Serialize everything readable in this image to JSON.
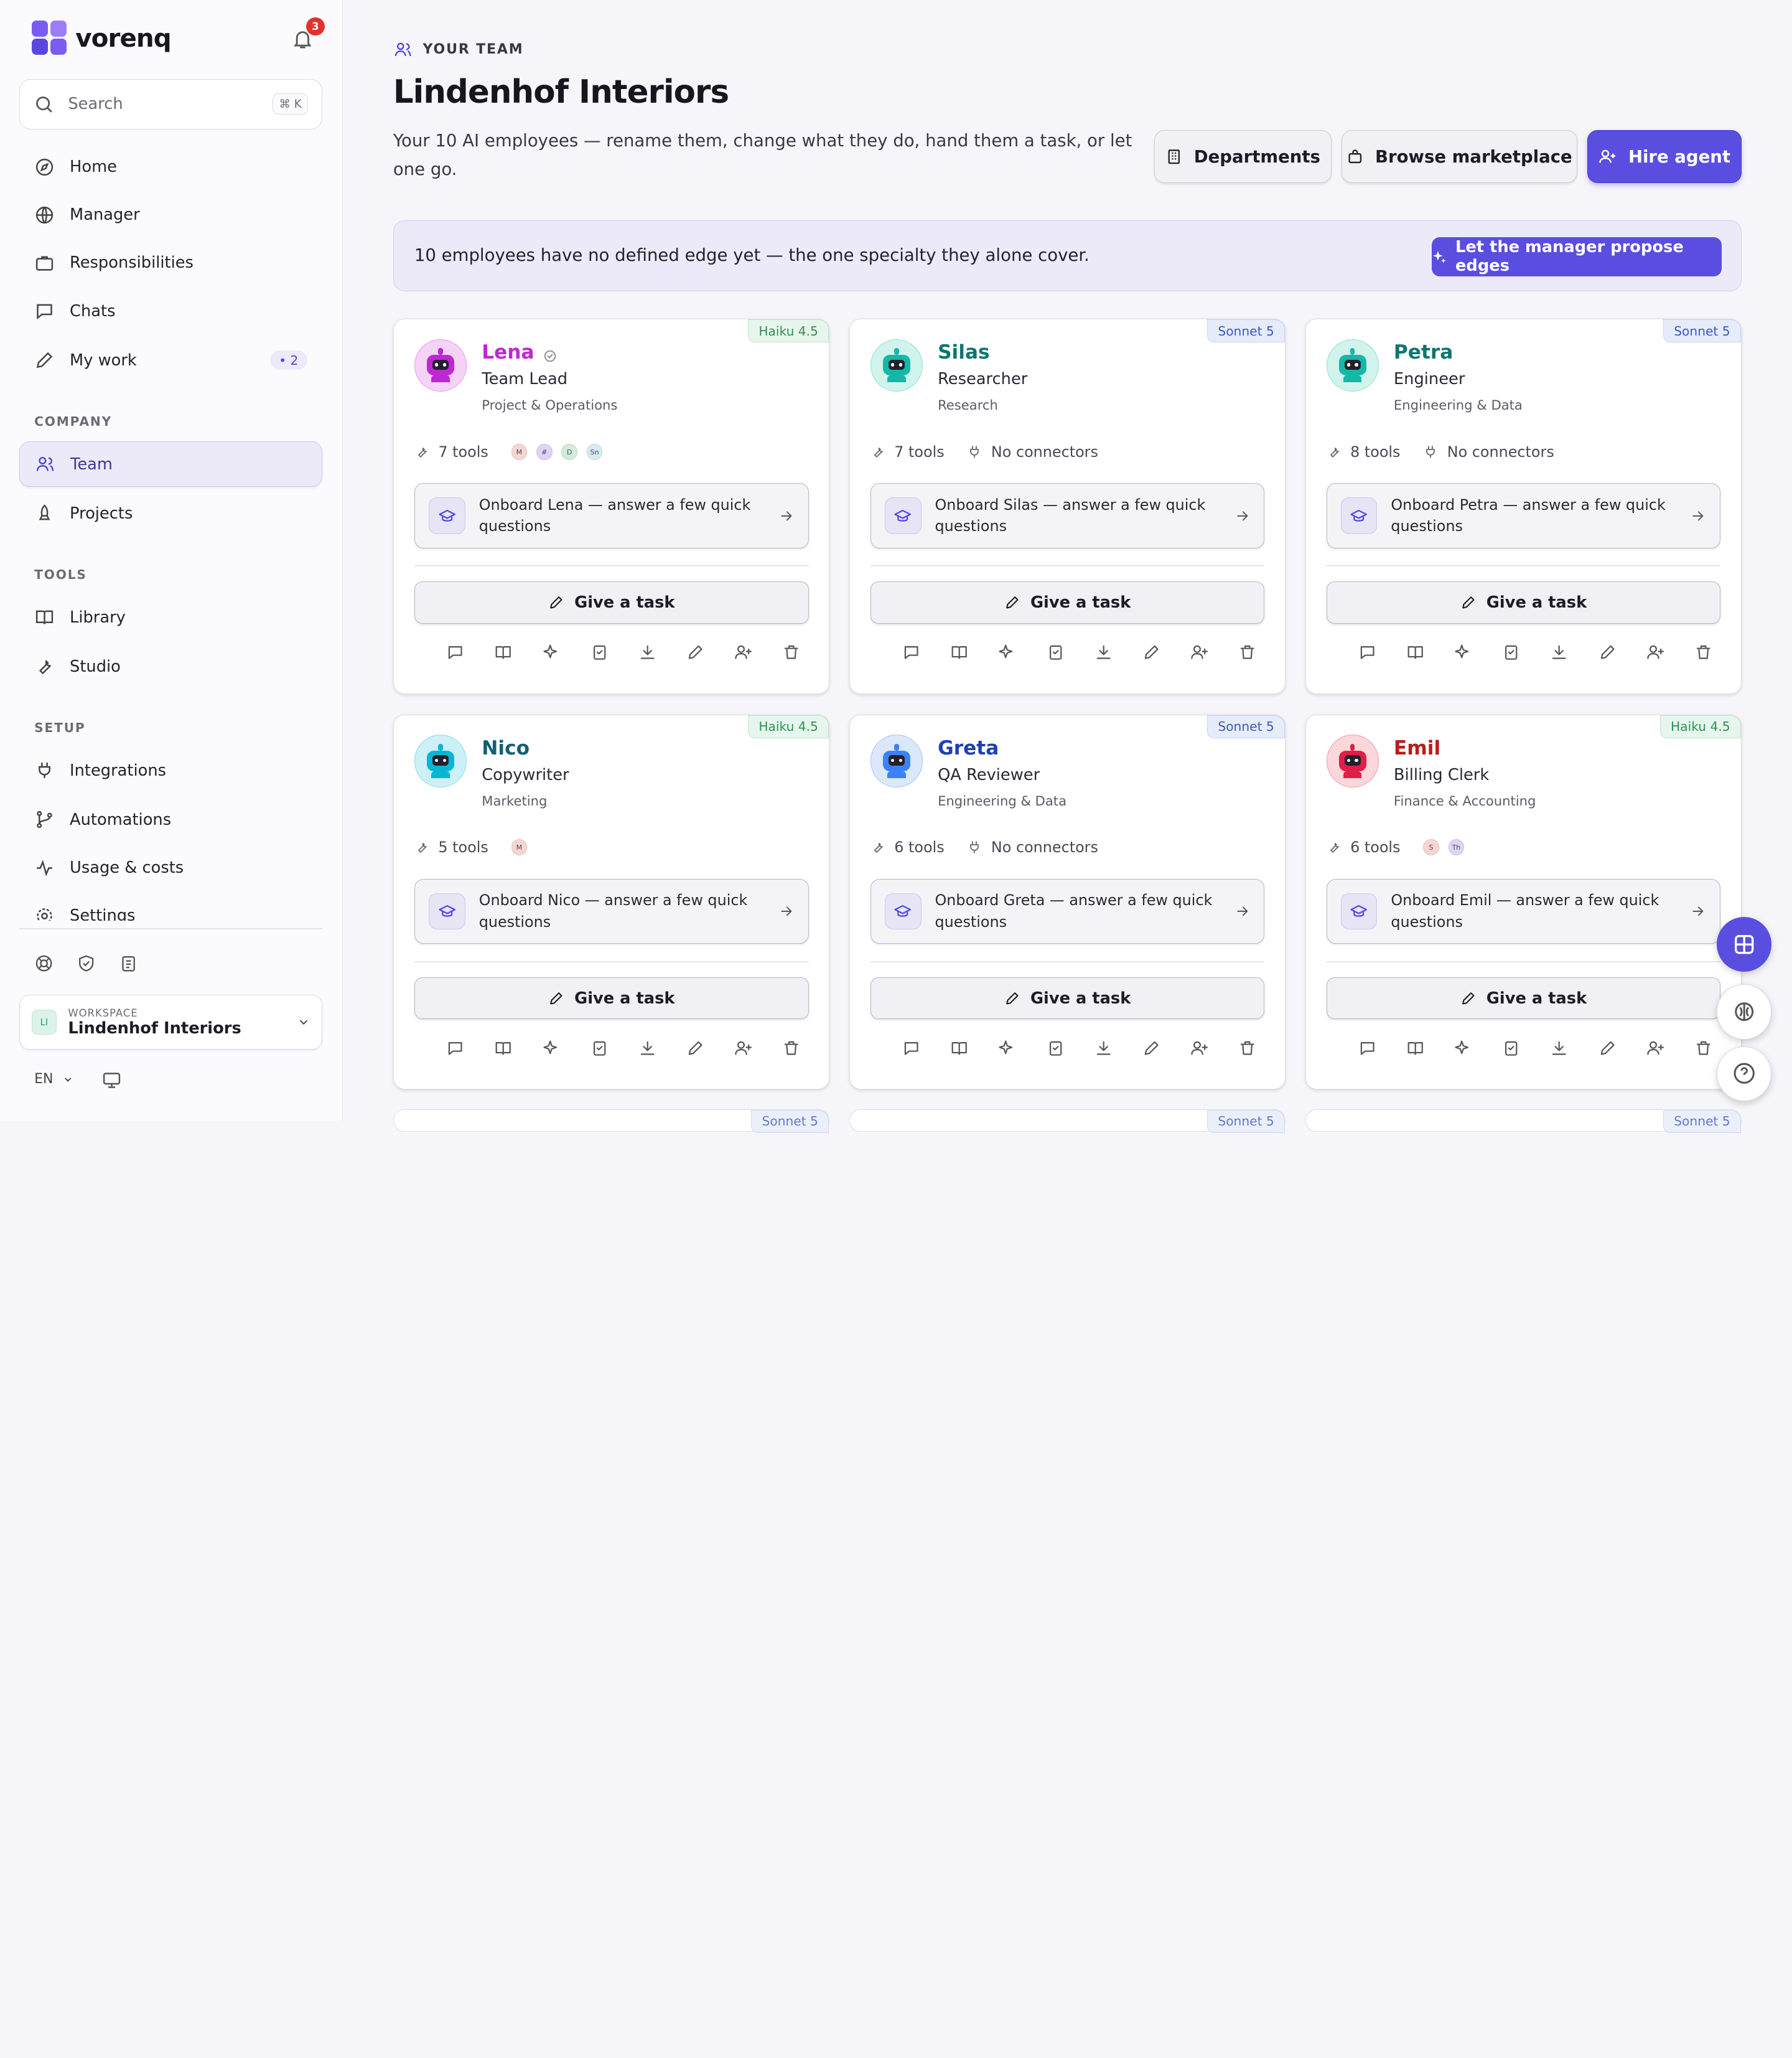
{
  "app": {
    "name": "vorenq",
    "notification_count": "3"
  },
  "search": {
    "placeholder": "Search",
    "shortcut": "⌘ K"
  },
  "nav": {
    "main": [
      {
        "label": "Home",
        "icon": "compass-icon"
      },
      {
        "label": "Manager",
        "icon": "globe-icon"
      },
      {
        "label": "Responsibilities",
        "icon": "briefcase-icon"
      },
      {
        "label": "Chats",
        "icon": "chat-icon"
      },
      {
        "label": "My work",
        "icon": "pencil-icon",
        "count": "• 2"
      }
    ],
    "company_title": "COMPANY",
    "company": [
      {
        "label": "Team"
      },
      {
        "label": "Projects"
      }
    ],
    "tools_title": "TOOLS",
    "tools": [
      {
        "label": "Library"
      },
      {
        "label": "Studio"
      }
    ],
    "setup_title": "SETUP",
    "setup": [
      {
        "label": "Integrations"
      },
      {
        "label": "Automations"
      },
      {
        "label": "Usage & costs"
      },
      {
        "label": "Settings"
      }
    ]
  },
  "workspace": {
    "label": "WORKSPACE",
    "name": "Lindenhof Interiors",
    "initials": "LI"
  },
  "language": "EN",
  "page": {
    "eyebrow": "YOUR TEAM",
    "title": "Lindenhof Interiors",
    "subtitle": "Your 10 AI employees — rename them, change what they do, hand them a task, or let one go.",
    "buttons": {
      "departments": "Departments",
      "marketplace": "Browse marketplace",
      "hire": "Hire agent"
    }
  },
  "banner": {
    "text": "10 employees have no defined edge yet — the one specialty they alone cover.",
    "action": "Let the manager propose edges"
  },
  "task_label": "Give a task",
  "agents": [
    {
      "name": "Lena",
      "role": "Team Lead",
      "dept": "Project & Operations",
      "model": "Haiku 4.5",
      "tools": "7 tools",
      "connectors": "",
      "chips": [
        "M",
        "#",
        "D",
        "Sn"
      ],
      "onboard": "Onboard Lena — answer a few quick questions",
      "color": "#c026d3",
      "verified": true
    },
    {
      "name": "Silas",
      "role": "Researcher",
      "dept": "Research",
      "model": "Sonnet 5",
      "tools": "7 tools",
      "connectors": "No connectors",
      "chips": [],
      "onboard": "Onboard Silas — answer a few quick questions",
      "color": "#0f766e"
    },
    {
      "name": "Petra",
      "role": "Engineer",
      "dept": "Engineering & Data",
      "model": "Sonnet 5",
      "tools": "8 tools",
      "connectors": "No connectors",
      "chips": [],
      "onboard": "Onboard Petra — answer a few quick questions",
      "color": "#0f766e"
    },
    {
      "name": "Nico",
      "role": "Copywriter",
      "dept": "Marketing",
      "model": "Haiku 4.5",
      "tools": "5 tools",
      "connectors": "",
      "chips": [
        "M"
      ],
      "onboard": "Onboard Nico — answer a few quick questions",
      "color": "#155e75"
    },
    {
      "name": "Greta",
      "role": "QA Reviewer",
      "dept": "Engineering & Data",
      "model": "Sonnet 5",
      "tools": "6 tools",
      "connectors": "No connectors",
      "chips": [],
      "onboard": "Onboard Greta — answer a few quick questions",
      "color": "#1e40af"
    },
    {
      "name": "Emil",
      "role": "Billing Clerk",
      "dept": "Finance & Accounting",
      "model": "Haiku 4.5",
      "tools": "6 tools",
      "connectors": "",
      "chips": [
        "S",
        "Th"
      ],
      "onboard": "Onboard Emil — answer a few quick questions",
      "color": "#b91c1c"
    }
  ],
  "peek_models": [
    "Sonnet 5",
    "Sonnet 5",
    "Sonnet 5"
  ]
}
